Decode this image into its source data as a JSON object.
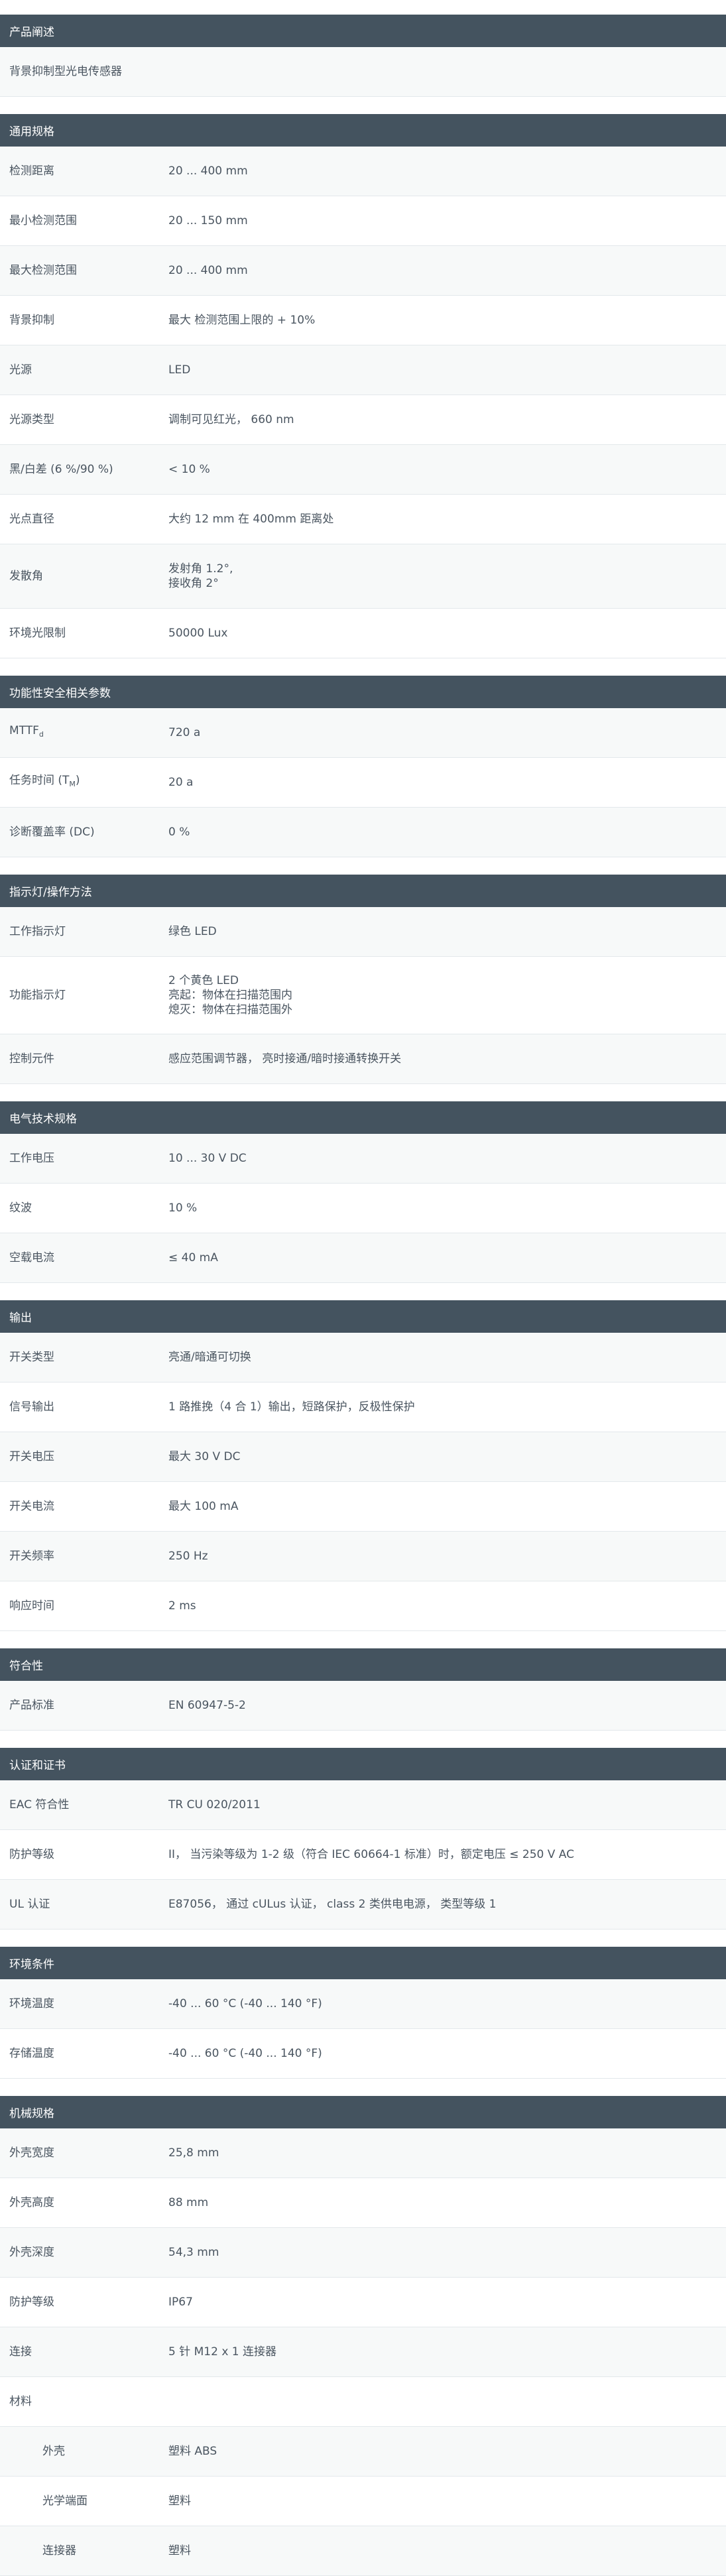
{
  "sections": [
    {
      "title": "产品阐述",
      "description": "背景抑制型光电传感器"
    },
    {
      "title": "通用规格",
      "rows": [
        {
          "label": "检测距离",
          "value": "20 ... 400 mm"
        },
        {
          "label": "最小检测范围",
          "value": "20 ... 150 mm"
        },
        {
          "label": "最大检测范围",
          "value": "20 ... 400 mm"
        },
        {
          "label": "背景抑制",
          "value": "最大 检测范围上限的 + 10%"
        },
        {
          "label": "光源",
          "value": "LED"
        },
        {
          "label": "光源类型",
          "value": "调制可见红光， 660 nm"
        },
        {
          "label": "黑/白差 (6 %/90 %)",
          "value": "< 10 %"
        },
        {
          "label": "光点直径",
          "value": "大约 12 mm 在 400mm 距离处"
        },
        {
          "label": "发散角",
          "value": "发射角 1.2°,\n接收角 2°"
        },
        {
          "label": "环境光限制",
          "value": "50000 Lux"
        }
      ]
    },
    {
      "title": "功能性安全相关参数",
      "rows": [
        {
          "label": "MTTF",
          "label_sub": "d",
          "value": "720 a"
        },
        {
          "label": "任务时间 (T",
          "label_sub": "M",
          "label_suffix": ")",
          "value": "20 a"
        },
        {
          "label": "诊断覆盖率 (DC)",
          "value": "0 %"
        }
      ]
    },
    {
      "title": "指示灯/操作方法",
      "rows": [
        {
          "label": "工作指示灯",
          "value": "绿色 LED"
        },
        {
          "label": "功能指示灯",
          "value": "2 个黄色 LED\n亮起：物体在扫描范围内\n熄灭：物体在扫描范围外"
        },
        {
          "label": "控制元件",
          "value": "感应范围调节器， 亮时接通/暗时接通转换开关"
        }
      ]
    },
    {
      "title": "电气技术规格",
      "rows": [
        {
          "label": "工作电压",
          "value": "10 ... 30 V DC"
        },
        {
          "label": "纹波",
          "value": "10 %"
        },
        {
          "label": "空载电流",
          "value": "≤ 40 mA"
        }
      ]
    },
    {
      "title": "输出",
      "rows": [
        {
          "label": "开关类型",
          "value": "亮通/暗通可切换"
        },
        {
          "label": "信号输出",
          "value": "1 路推挽（4 合 1）输出，短路保护，反极性保护"
        },
        {
          "label": "开关电压",
          "value": "最大 30 V DC"
        },
        {
          "label": "开关电流",
          "value": "最大 100 mA"
        },
        {
          "label": "开关频率",
          "value": "250 Hz"
        },
        {
          "label": "响应时间",
          "value": "2 ms"
        }
      ]
    },
    {
      "title": "符合性",
      "rows": [
        {
          "label": "产品标准",
          "value": "EN 60947-5-2"
        }
      ]
    },
    {
      "title": "认证和证书",
      "rows": [
        {
          "label": "EAC 符合性",
          "value": "TR CU 020/2011"
        },
        {
          "label": "防护等级",
          "value": "II， 当污染等级为 1-2 级（符合 IEC 60664-1 标准）时，额定电压 ≤ 250 V AC"
        },
        {
          "label": "UL 认证",
          "value": "E87056， 通过 cULus 认证， class 2 类供电电源， 类型等级 1"
        }
      ]
    },
    {
      "title": "环境条件",
      "rows": [
        {
          "label": "环境温度",
          "value": "-40 ... 60 °C (-40 ... 140 °F)"
        },
        {
          "label": "存储温度",
          "value": "-40 ... 60 °C (-40 ... 140 °F)"
        }
      ]
    },
    {
      "title": "机械规格",
      "rows": [
        {
          "label": "外壳宽度",
          "value": "25,8 mm"
        },
        {
          "label": "外壳高度",
          "value": "88 mm"
        },
        {
          "label": "外壳深度",
          "value": "54,3 mm"
        },
        {
          "label": "防护等级",
          "value": "IP67"
        },
        {
          "label": "连接",
          "value": "5 针 M12 x 1 连接器"
        },
        {
          "label": "材料",
          "value": ""
        },
        {
          "label": "外壳",
          "value": "塑料 ABS",
          "indent": true
        },
        {
          "label": "光学端面",
          "value": "塑料",
          "indent": true
        },
        {
          "label": "连接器",
          "value": "塑料",
          "indent": true
        }
      ]
    }
  ]
}
